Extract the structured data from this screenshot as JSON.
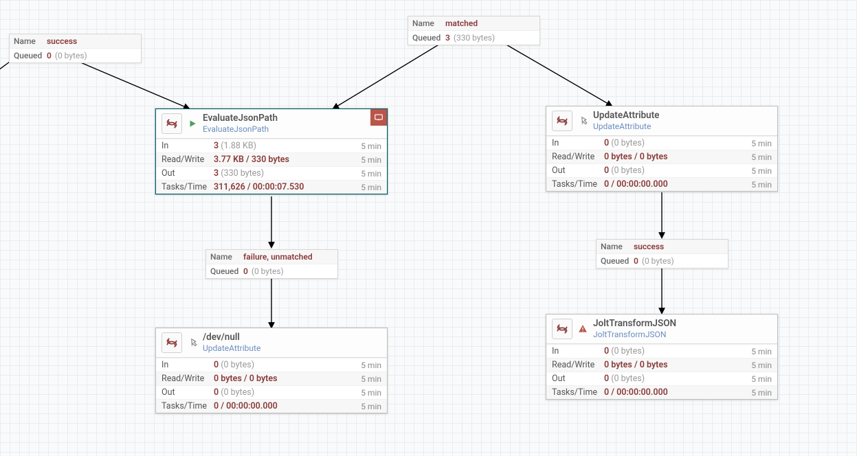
{
  "connections": {
    "success1": {
      "nameLabel": "Name",
      "name": "success",
      "queuedLabel": "Queued",
      "queuedCount": "0",
      "queuedSize": "(0 bytes)"
    },
    "matched": {
      "nameLabel": "Name",
      "name": "matched",
      "queuedLabel": "Queued",
      "queuedCount": "3",
      "queuedSize": "(330 bytes)"
    },
    "failure": {
      "nameLabel": "Name",
      "name": "failure, unmatched",
      "queuedLabel": "Queued",
      "queuedCount": "0",
      "queuedSize": "(0 bytes)"
    },
    "success2": {
      "nameLabel": "Name",
      "name": "success",
      "queuedLabel": "Queued",
      "queuedCount": "0",
      "queuedSize": "(0 bytes)"
    }
  },
  "labels": {
    "in": "In",
    "rw": "Read/Write",
    "out": "Out",
    "tt": "Tasks/Time",
    "time": "5 min"
  },
  "processors": {
    "evalJson": {
      "title": "EvaluateJsonPath",
      "subtype": "EvaluateJsonPath",
      "in": {
        "count": "3",
        "size": "(1.88 KB)"
      },
      "rw": "3.77 KB / 330 bytes",
      "out": {
        "count": "3",
        "size": "(330 bytes)"
      },
      "tt": "311,626 / 00:00:07.530"
    },
    "updateAttr": {
      "title": "UpdateAttribute",
      "subtype": "UpdateAttribute",
      "in": {
        "count": "0",
        "size": "(0 bytes)"
      },
      "rw": "0 bytes / 0 bytes",
      "out": {
        "count": "0",
        "size": "(0 bytes)"
      },
      "tt": "0 / 00:00:00.000"
    },
    "devnull": {
      "title": "/dev/null",
      "subtype": "UpdateAttribute",
      "in": {
        "count": "0",
        "size": "(0 bytes)"
      },
      "rw": "0 bytes / 0 bytes",
      "out": {
        "count": "0",
        "size": "(0 bytes)"
      },
      "tt": "0 / 00:00:00.000"
    },
    "jolt": {
      "title": "JoltTransformJSON",
      "subtype": "JoltTransformJSON",
      "in": {
        "count": "0",
        "size": "(0 bytes)"
      },
      "rw": "0 bytes / 0 bytes",
      "out": {
        "count": "0",
        "size": "(0 bytes)"
      },
      "tt": "0 / 00:00:00.000"
    }
  }
}
